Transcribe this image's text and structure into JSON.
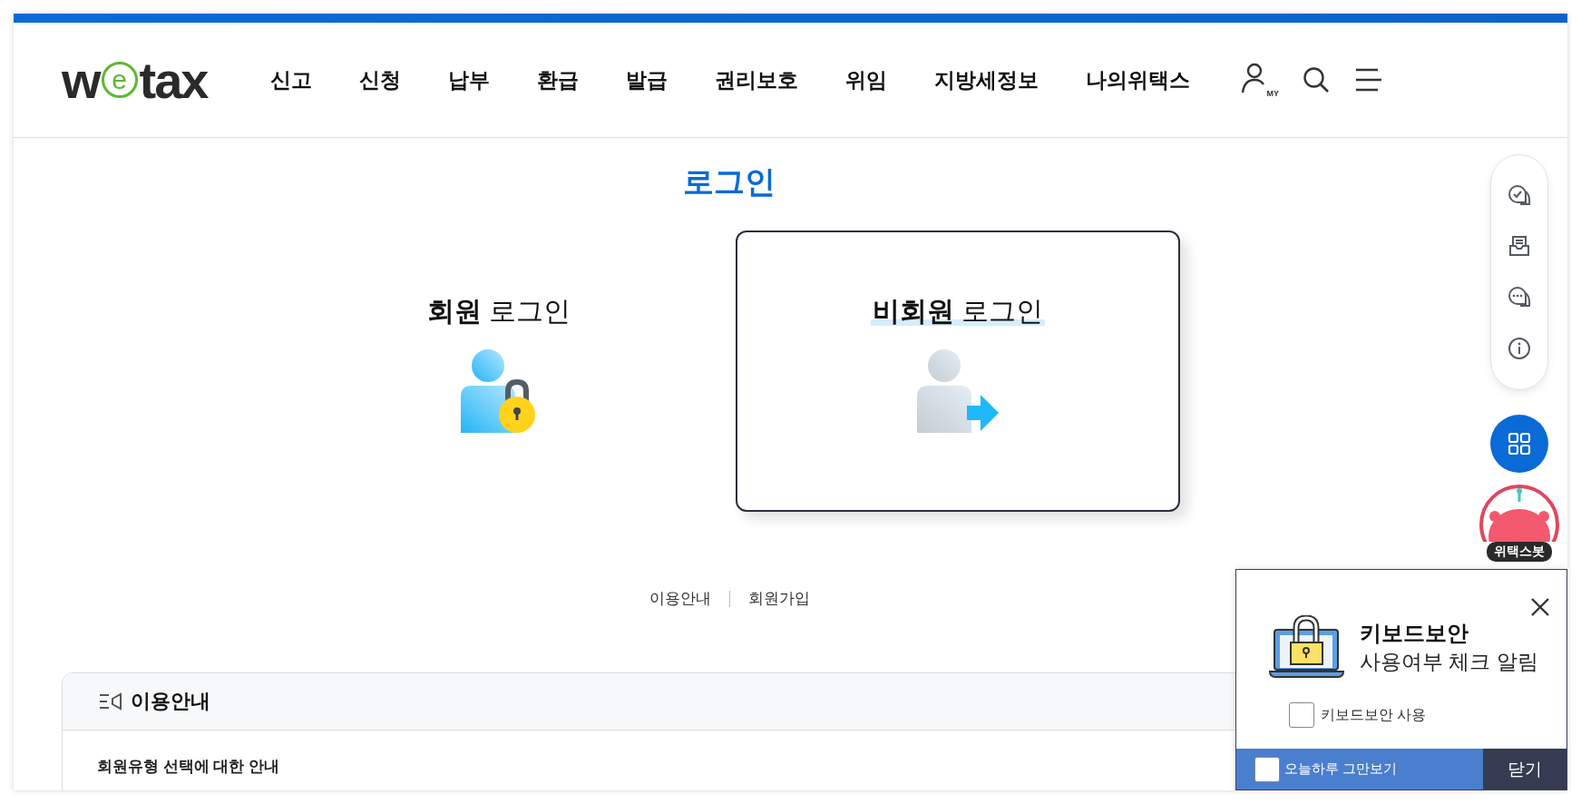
{
  "logo": "wetax",
  "nav": [
    "신고",
    "신청",
    "납부",
    "환급",
    "발급",
    "권리보호",
    "위임",
    "지방세정보",
    "나의위택스"
  ],
  "my_label": "MY",
  "page_title": "로그인",
  "login_options": [
    {
      "label": "**회원** 로그인",
      "kind": "member",
      "selected": false
    },
    {
      "label": "**비회원** 로그인",
      "kind": "guest",
      "selected": true
    }
  ],
  "links": [
    "이용안내",
    "회원가입"
  ],
  "info_panel": {
    "title": "이용안내",
    "subtitle": "회원유형 선택에 대한 안내"
  },
  "bot": {
    "label": "위택스봇"
  },
  "keyboard_popup": {
    "title": "키보드보안",
    "subtitle": "사용여부 체크 알림",
    "option": {
      "label": "키보드보안 사용",
      "checked": false
    },
    "dont_show_today": {
      "label": "오늘하루 그만보기",
      "checked": false
    },
    "close_button": "닫기"
  }
}
